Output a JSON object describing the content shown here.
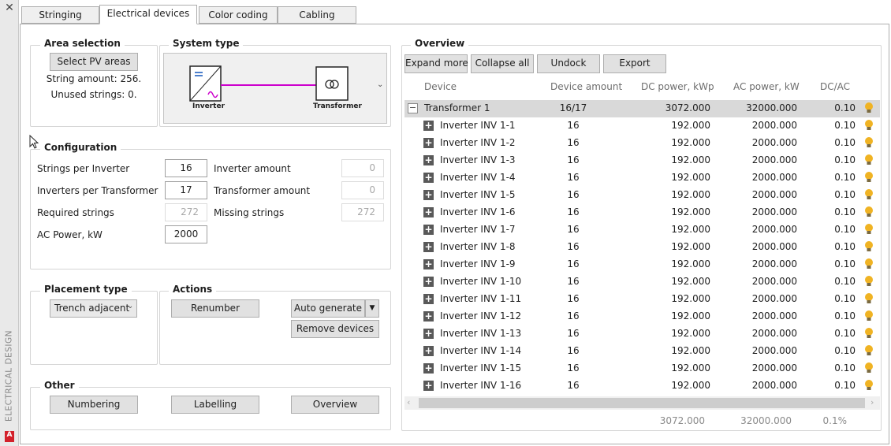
{
  "sidebar": {
    "title": "ELECTRICAL DESIGN",
    "close": "✕",
    "logo": "A"
  },
  "tabs": [
    "Stringing",
    "Electrical devices",
    "Color coding",
    "Cabling"
  ],
  "area_selection": {
    "title": "Area selection",
    "button": "Select PV areas",
    "string_amount": "String amount: 256.",
    "unused_strings": "Unused strings: 0."
  },
  "system_type": {
    "title": "System type",
    "inverter": "Inverter",
    "transformer": "Transformer",
    "colors": {
      "line": "#cc00cc",
      "inverter_wave": "#cc00cc",
      "inverter_lines": "#1f5fbf"
    }
  },
  "configuration": {
    "title": "Configuration",
    "strings_per_inverter": {
      "label": "Strings per Inverter",
      "value": "16"
    },
    "inverters_per_transformer": {
      "label": "Inverters per Transformer",
      "value": "17"
    },
    "required_strings": {
      "label": "Required strings",
      "value": "272"
    },
    "ac_power": {
      "label": "AC Power, kW",
      "value": "2000"
    },
    "inverter_amount": {
      "label": "Inverter amount",
      "value": "0"
    },
    "transformer_amount": {
      "label": "Transformer amount",
      "value": "0"
    },
    "missing_strings": {
      "label": "Missing strings",
      "value": "272"
    }
  },
  "placement": {
    "title": "Placement type",
    "value": "Trench adjacent"
  },
  "actions": {
    "title": "Actions",
    "renumber": "Renumber",
    "auto_generate": "Auto generate",
    "remove_devices": "Remove devices"
  },
  "other": {
    "title": "Other",
    "numbering": "Numbering",
    "labelling": "Labelling",
    "overview": "Overview"
  },
  "overview": {
    "title": "Overview",
    "toolbar": {
      "expand_more": "Expand more",
      "collapse_all": "Collapse all",
      "undock": "Undock",
      "export": "Export"
    },
    "columns": [
      "Device",
      "Device amount",
      "DC power, kWp",
      "AC power, kW",
      "DC/AC"
    ],
    "transformer": {
      "device": "Transformer 1",
      "amount": "16/17",
      "dc": "3072.000",
      "ac": "32000.000",
      "ratio": "0.10"
    },
    "inverters": [
      {
        "device": "Inverter INV 1-1",
        "amount": "16",
        "dc": "192.000",
        "ac": "2000.000",
        "ratio": "0.10"
      },
      {
        "device": "Inverter INV 1-2",
        "amount": "16",
        "dc": "192.000",
        "ac": "2000.000",
        "ratio": "0.10"
      },
      {
        "device": "Inverter INV 1-3",
        "amount": "16",
        "dc": "192.000",
        "ac": "2000.000",
        "ratio": "0.10"
      },
      {
        "device": "Inverter INV 1-4",
        "amount": "16",
        "dc": "192.000",
        "ac": "2000.000",
        "ratio": "0.10"
      },
      {
        "device": "Inverter INV 1-5",
        "amount": "16",
        "dc": "192.000",
        "ac": "2000.000",
        "ratio": "0.10"
      },
      {
        "device": "Inverter INV 1-6",
        "amount": "16",
        "dc": "192.000",
        "ac": "2000.000",
        "ratio": "0.10"
      },
      {
        "device": "Inverter INV 1-7",
        "amount": "16",
        "dc": "192.000",
        "ac": "2000.000",
        "ratio": "0.10"
      },
      {
        "device": "Inverter INV 1-8",
        "amount": "16",
        "dc": "192.000",
        "ac": "2000.000",
        "ratio": "0.10"
      },
      {
        "device": "Inverter INV 1-9",
        "amount": "16",
        "dc": "192.000",
        "ac": "2000.000",
        "ratio": "0.10"
      },
      {
        "device": "Inverter INV 1-10",
        "amount": "16",
        "dc": "192.000",
        "ac": "2000.000",
        "ratio": "0.10"
      },
      {
        "device": "Inverter INV 1-11",
        "amount": "16",
        "dc": "192.000",
        "ac": "2000.000",
        "ratio": "0.10"
      },
      {
        "device": "Inverter INV 1-12",
        "amount": "16",
        "dc": "192.000",
        "ac": "2000.000",
        "ratio": "0.10"
      },
      {
        "device": "Inverter INV 1-13",
        "amount": "16",
        "dc": "192.000",
        "ac": "2000.000",
        "ratio": "0.10"
      },
      {
        "device": "Inverter INV 1-14",
        "amount": "16",
        "dc": "192.000",
        "ac": "2000.000",
        "ratio": "0.10"
      },
      {
        "device": "Inverter INV 1-15",
        "amount": "16",
        "dc": "192.000",
        "ac": "2000.000",
        "ratio": "0.10"
      },
      {
        "device": "Inverter INV 1-16",
        "amount": "16",
        "dc": "192.000",
        "ac": "2000.000",
        "ratio": "0.10"
      }
    ],
    "footer": {
      "dc_total": "3072.000",
      "ac_total": "32000.000",
      "ratio": "0.1%"
    },
    "bulb_color": "#f0b323"
  }
}
